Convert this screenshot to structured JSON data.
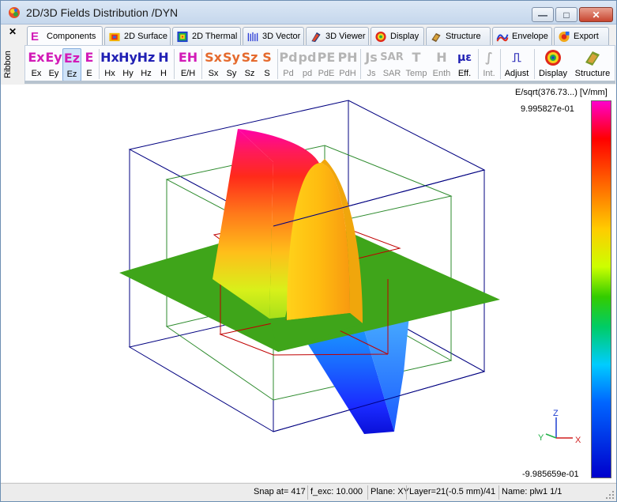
{
  "window": {
    "title": "2D/3D Fields Distribution /DYN",
    "minimize_label": "—",
    "maximize_label": "□",
    "close_label": "✕"
  },
  "ribbon": {
    "close_label": "✕",
    "side_label": "Ribbon"
  },
  "tabs": [
    {
      "label": "Components",
      "icon": "components-icon",
      "active": true
    },
    {
      "label": "2D Surface",
      "icon": "surface-icon"
    },
    {
      "label": "2D Thermal",
      "icon": "thermal-icon"
    },
    {
      "label": "3D Vector",
      "icon": "vector-icon"
    },
    {
      "label": "3D Viewer",
      "icon": "viewer-icon"
    },
    {
      "label": "Display",
      "icon": "display-icon"
    },
    {
      "label": "Structure",
      "icon": "structure-icon"
    },
    {
      "label": "Envelope",
      "icon": "envelope-icon"
    },
    {
      "label": "Export",
      "icon": "export-icon"
    }
  ],
  "toolbar": {
    "buttons": [
      {
        "glyph": "Ex",
        "label": "Ex"
      },
      {
        "glyph": "Ey",
        "label": "Ey"
      },
      {
        "glyph": "Ez",
        "label": "Ez",
        "selected": true
      },
      {
        "glyph": "E",
        "label": "E"
      },
      {
        "glyph": "Hx",
        "label": "Hx"
      },
      {
        "glyph": "Hy",
        "label": "Hy"
      },
      {
        "glyph": "Hz",
        "label": "Hz"
      },
      {
        "glyph": "H",
        "label": "H"
      },
      {
        "glyph": "EH",
        "label": "E/H"
      },
      {
        "glyph": "Sx",
        "label": "Sx"
      },
      {
        "glyph": "Sy",
        "label": "Sy"
      },
      {
        "glyph": "Sz",
        "label": "Sz"
      },
      {
        "glyph": "S",
        "label": "S"
      },
      {
        "glyph": "Pd",
        "label": "Pd"
      },
      {
        "glyph": "pd",
        "label": "pd"
      },
      {
        "glyph": "PE",
        "label": "PdE"
      },
      {
        "glyph": "PH",
        "label": "PdH"
      },
      {
        "glyph": "Js",
        "label": "Js"
      },
      {
        "glyph": "SAR",
        "label": "SAR"
      },
      {
        "glyph": "T",
        "label": "Temp"
      },
      {
        "glyph": "H",
        "label": "Enth"
      },
      {
        "glyph": "με",
        "label": "Eff."
      },
      {
        "glyph": "∫",
        "label": "Int."
      },
      {
        "glyph": "⎍",
        "label": "Adjust"
      },
      {
        "glyph": "",
        "label": "Display"
      },
      {
        "glyph": "",
        "label": "Structure"
      }
    ]
  },
  "legend": {
    "unit": "E/sqrt(376.73...) [V/mm]",
    "max": "9.995827e-01",
    "min": "-9.985659e-01"
  },
  "axes": {
    "x": "X",
    "y": "Y",
    "z": "Z"
  },
  "status": {
    "snap": "Snap at= 417",
    "f_exc": "f_exc: 10.000",
    "plane": "Plane: XY",
    "layer": "Layer=21(-0.5 mm)/41",
    "name": "Name: plw1 1/1"
  },
  "colors": {
    "plane": "#3fa51a",
    "outer_box": "#000080",
    "inner_box": "#2e8b2e",
    "red_box": "#c00000"
  }
}
